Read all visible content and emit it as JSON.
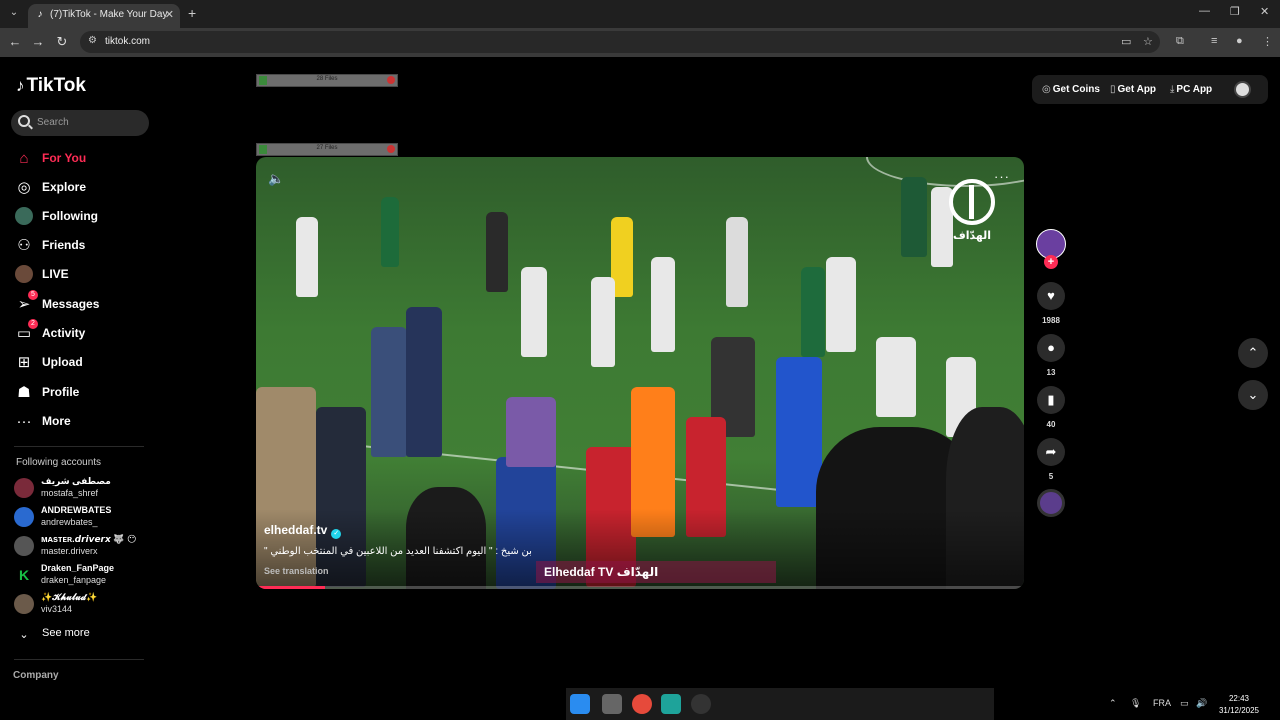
{
  "browser": {
    "tab_title": "(7)TikTok - Make Your Day",
    "url": "tiktok.com"
  },
  "sidebar": {
    "logo": "TikTok",
    "search_placeholder": "Search",
    "nav": [
      {
        "label": "For You",
        "icon": "home-icon",
        "active": true
      },
      {
        "label": "Explore",
        "icon": "compass-icon"
      },
      {
        "label": "Following",
        "icon": "following-avatar-icon"
      },
      {
        "label": "Friends",
        "icon": "friends-icon"
      },
      {
        "label": "LIVE",
        "icon": "live-avatar-icon"
      },
      {
        "label": "Messages",
        "icon": "messages-icon",
        "badge": "5"
      },
      {
        "label": "Activity",
        "icon": "activity-icon",
        "badge": "2"
      },
      {
        "label": "Upload",
        "icon": "upload-icon"
      },
      {
        "label": "Profile",
        "icon": "profile-icon"
      },
      {
        "label": "More",
        "icon": "more-icon"
      }
    ],
    "following_title": "Following accounts",
    "accounts": [
      {
        "name": "مصطفى شريف",
        "handle": "mostafa_shref",
        "color": "#7a2a3a"
      },
      {
        "name": "ANDREWBATES",
        "handle": "andrewbates_",
        "color": "#2a6ad0"
      },
      {
        "name": "ᴍᴀsᴛᴇʀ.𝙙𝙧𝙞𝙫𝙚𝙧𝙭 🐺 😶",
        "handle": "master.driverx",
        "color": "#555555"
      },
      {
        "name": "Draken_FanPage",
        "handle": "draken_fanpage",
        "color": "#18c045"
      },
      {
        "name": "✨𝓚𝓱𝓾𝓵𝓾𝓭✨",
        "handle": "viv3144",
        "color": "#6b5a4a"
      }
    ],
    "see_more": "See more",
    "company": "Company"
  },
  "header": {
    "get_coins": "Get Coins",
    "get_app": "Get App",
    "pc_app": "PC App"
  },
  "file_widgets": [
    {
      "label": "28 Files"
    },
    {
      "label": "27 Files"
    }
  ],
  "video": {
    "author": "elheddaf.tv",
    "caption": "بن شيخ : \" اليوم اكتشفنا العديد من اللاعبين في المنتخب الوطني \"",
    "see_translation": "See translation",
    "watermark_text": "الهدّاف",
    "brand_bar": "Elheddaf TV الهدّاف",
    "progress": 0.09
  },
  "actions": {
    "likes": "1988",
    "comments": "13",
    "saves": "40",
    "shares": "5"
  },
  "taskbar": {
    "lang": "FRA",
    "time": "22:43",
    "date": "31/12/2025"
  }
}
